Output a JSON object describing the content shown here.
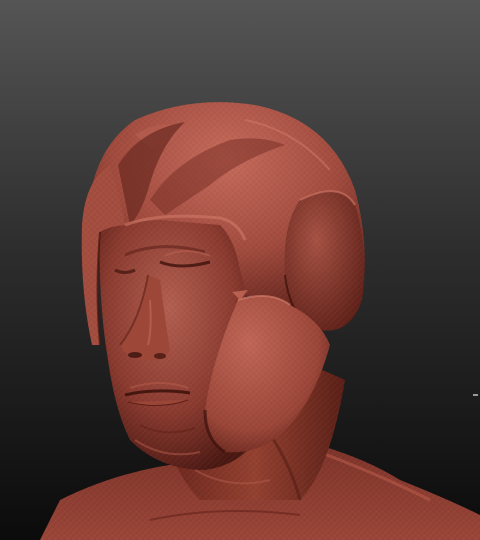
{
  "scene": {
    "subject": "sculpted-head-with-helmet",
    "colors": {
      "background_top": "#505050",
      "background_bottom": "#0c0c0c",
      "clay_light": "#b8604f",
      "clay_mid": "#8e3d31",
      "clay_dark": "#4e1a14",
      "clay_shadow": "#2a0c09",
      "helmet_light": "#c4695a",
      "helmet_mid": "#9a4539",
      "edge_marker": "#9a9a9a"
    }
  }
}
